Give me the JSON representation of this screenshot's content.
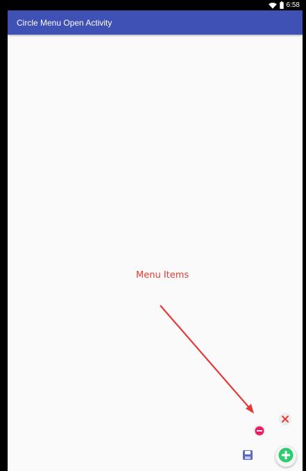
{
  "status_bar": {
    "time": "6:58",
    "icons": [
      "wifi-icon",
      "battery-icon"
    ]
  },
  "app_bar": {
    "title": "Circle Menu Open Activity",
    "color": "#3f51b5"
  },
  "annotation": {
    "label": "Menu Items",
    "color": "#e53935"
  },
  "menu": {
    "items": [
      {
        "icon": "close-icon",
        "color": "#e53935"
      },
      {
        "icon": "remove-icon",
        "color": "#e91e63"
      },
      {
        "icon": "save-icon",
        "color": "#5c6bc0"
      }
    ],
    "main_button": {
      "icon": "add-icon",
      "color": "#2ecc71"
    }
  },
  "colors": {
    "screen_background": "#fafafa",
    "status_bar": "#000000"
  }
}
